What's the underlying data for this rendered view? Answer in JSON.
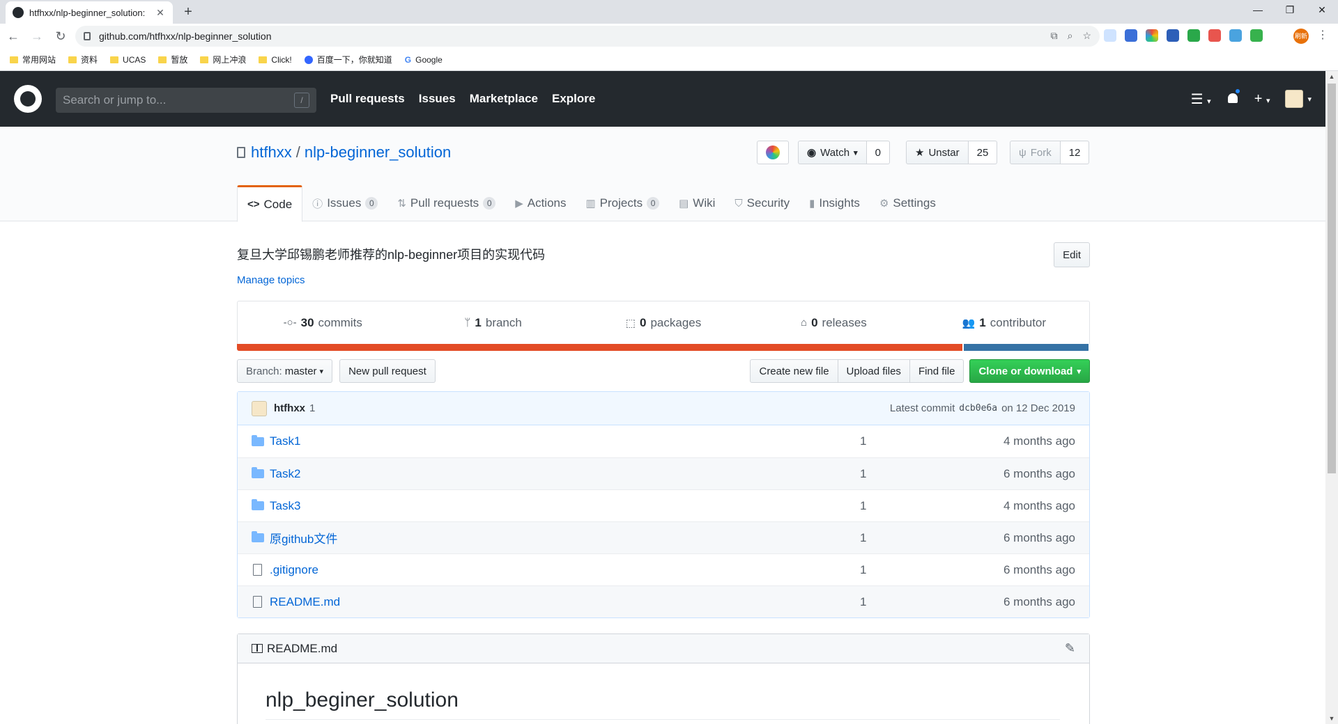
{
  "browser": {
    "tab_title": "htfhxx/nlp-beginner_solution:",
    "url": "github.com/htfhxx/nlp-beginner_solution",
    "profile_text": "刷新",
    "bookmarks": [
      "常用网站",
      "资料",
      "UCAS",
      "暂放",
      "网上冲浪",
      "Click!",
      "百度一下，你就知道",
      "Google"
    ]
  },
  "header": {
    "search_placeholder": "Search or jump to...",
    "search_shortcut": "/",
    "nav": [
      "Pull requests",
      "Issues",
      "Marketplace",
      "Explore"
    ]
  },
  "repo": {
    "owner": "htfhxx",
    "separator": "/",
    "name": "nlp-beginner_solution",
    "watch_label": "Watch",
    "watch_count": "0",
    "star_label": "Unstar",
    "star_count": "25",
    "fork_label": "Fork",
    "fork_count": "12"
  },
  "tabs": [
    {
      "icon": "code-icon",
      "label": "Code",
      "count": ""
    },
    {
      "icon": "issue-icon",
      "label": "Issues",
      "count": "0"
    },
    {
      "icon": "pull-request-icon",
      "label": "Pull requests",
      "count": "0"
    },
    {
      "icon": "actions-icon",
      "label": "Actions",
      "count": ""
    },
    {
      "icon": "project-icon",
      "label": "Projects",
      "count": "0"
    },
    {
      "icon": "wiki-icon",
      "label": "Wiki",
      "count": ""
    },
    {
      "icon": "shield-icon",
      "label": "Security",
      "count": ""
    },
    {
      "icon": "graph-icon",
      "label": "Insights",
      "count": ""
    },
    {
      "icon": "gear-icon",
      "label": "Settings",
      "count": ""
    }
  ],
  "description": "复旦大学邱锡鹏老师推荐的nlp-beginner项目的实现代码",
  "edit_label": "Edit",
  "manage_topics": "Manage topics",
  "summary": [
    {
      "count": "30",
      "label": "commits"
    },
    {
      "count": "1",
      "label": "branch"
    },
    {
      "count": "0",
      "label": "packages"
    },
    {
      "count": "0",
      "label": "releases"
    },
    {
      "count": "1",
      "label": "contributor"
    }
  ],
  "languages": [
    {
      "color": "#e34c26",
      "share": 85.3
    },
    {
      "color": "#3572A5",
      "share": 14.7
    }
  ],
  "file_nav": {
    "branch_prefix": "Branch:",
    "branch": "master",
    "new_pr": "New pull request",
    "create_file": "Create new file",
    "upload": "Upload files",
    "find": "Find file",
    "clone": "Clone or download"
  },
  "latest_commit": {
    "author": "htfhxx",
    "message": "1",
    "prefix": "Latest commit",
    "sha": "dcb0e6a",
    "date": "on 12 Dec 2019"
  },
  "files": [
    {
      "type": "folder",
      "name": "Task1",
      "message": "1",
      "age": "4 months ago"
    },
    {
      "type": "folder",
      "name": "Task2",
      "message": "1",
      "age": "6 months ago"
    },
    {
      "type": "folder",
      "name": "Task3",
      "message": "1",
      "age": "4 months ago"
    },
    {
      "type": "folder",
      "name": "原github文件",
      "message": "1",
      "age": "6 months ago"
    },
    {
      "type": "file",
      "name": ".gitignore",
      "message": "1",
      "age": "6 months ago"
    },
    {
      "type": "file",
      "name": "README.md",
      "message": "1",
      "age": "6 months ago"
    }
  ],
  "readme": {
    "filename": "README.md",
    "heading": "nlp_beginer_solution"
  }
}
